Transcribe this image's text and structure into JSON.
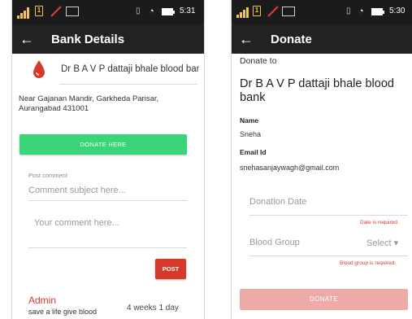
{
  "left_screen": {
    "status": {
      "time": "5:31",
      "sim_label": "1"
    },
    "appbar": {
      "back_glyph": "←",
      "title": "Bank Details"
    },
    "bank_name": "Dr B A V P dattaji bhale blood bank",
    "address": "Near Gajanan Mandir, Garkheda Parisar, Aurangabad 431001",
    "donate_here_label": "DONATE HERE",
    "post_comment_label": "Post comment",
    "comment_subject_placeholder": "Comment subject here...",
    "comment_body_placeholder": "Your comment here...",
    "post_button_label": "POST",
    "comment": {
      "author": "Admin",
      "text": "save a life give blood",
      "time": "4 weeks 1 day"
    }
  },
  "right_screen": {
    "status": {
      "time": "5:30",
      "sim_label": "1"
    },
    "appbar": {
      "back_glyph": "←",
      "title": "Donate"
    },
    "donate_to_label": "Donate to",
    "bank_name": "Dr B A V P dattaji bhale blood bank",
    "name_label": "Name",
    "name_value": "Sneha",
    "email_label": "Email Id",
    "email_value": "snehasanjaywagh@gmail.com",
    "donation_date_placeholder": "Donation Date",
    "date_error": "Date is required.",
    "blood_group_label": "Blood Group",
    "blood_group_value": "Select",
    "dropdown_glyph": "▾",
    "blood_group_error": "Blood group is required.",
    "donate_button_label": "DONATE"
  },
  "colors": {
    "appbar": "#222222",
    "donate_here": "#3ad579",
    "accent_red": "#d6392a",
    "donate_disabled": "#eeaaa7",
    "signal": "#f2c64a"
  },
  "icons": {
    "drop": "blood-drop-icon",
    "back": "back-arrow-icon",
    "signal": "signal-icon",
    "wifi": "wifi-icon",
    "battery": "battery-icon",
    "vibrate": "vibrate-icon",
    "no_data": "no-data-icon"
  }
}
